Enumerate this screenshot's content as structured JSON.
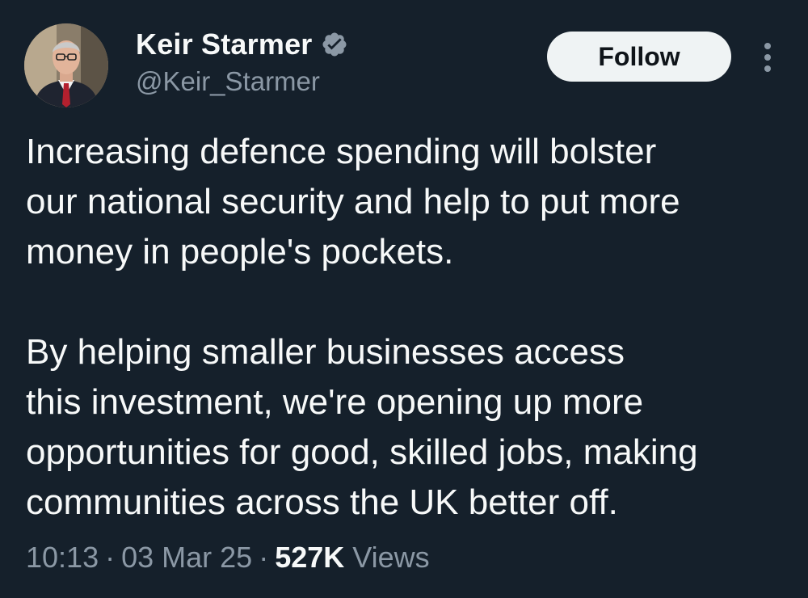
{
  "author": {
    "display_name": "Keir Starmer",
    "handle": "@Keir_Starmer",
    "verified": true,
    "verified_color": "#1d9bf0",
    "avatar_icon": "profile-photo"
  },
  "actions": {
    "follow_label": "Follow",
    "more_icon": "more-vertical-icon"
  },
  "tweet": {
    "paragraphs": [
      "Increasing defence spending will bolster\nour national security and help to put more\nmoney in people's pockets.",
      "By helping smaller businesses access\nthis investment, we're opening up more\nopportunities for good, skilled jobs, making\ncommunities across the UK better off."
    ]
  },
  "meta": {
    "time": "10:13",
    "date": "03 Mar 25",
    "separator": "·",
    "views_count": "527K",
    "views_label": "Views"
  },
  "colors": {
    "background": "#15202b",
    "primary_text": "#f7f9f9",
    "secondary_text": "#8b98a5",
    "button_bg": "#eff3f4",
    "button_text": "#0f1419"
  }
}
